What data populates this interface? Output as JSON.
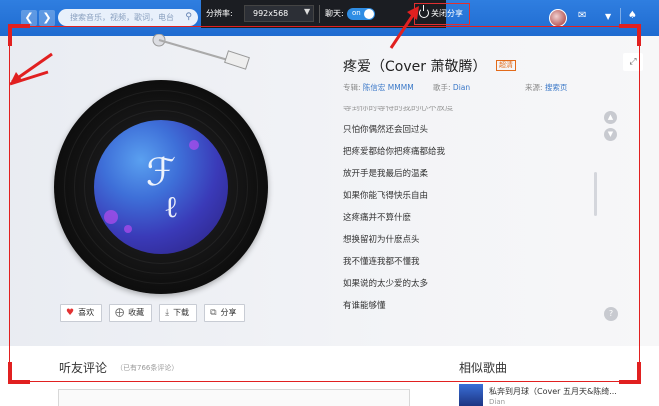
{
  "header": {
    "search_placeholder": "搜索音乐，视频，歌词，电台",
    "share_bar": {
      "resolution_label": "分辨率:",
      "resolution_value": "992x568",
      "chat_label": "聊天:",
      "chat_toggle": "on",
      "close_share_label": "关闭分享"
    }
  },
  "song": {
    "title": "疼爱（Cover 萧敬腾）",
    "badge": "超清",
    "album_label": "专辑:",
    "album_value": "陈信宏 MMMM",
    "artist_label": "歌手:",
    "artist_value": "Dian",
    "source_label": "来源:",
    "source_value": "搜索页"
  },
  "lyrics": [
    "等到你的等待的我的心不放度",
    "只怕你偶然还会回过头",
    "把疼爱都给你把疼痛都给我",
    "放开手是我最后的温柔",
    "如果你能飞得快乐自由",
    "这疼痛并不算什麽",
    "想换留初为什麽点头",
    "我不懂连我都不懂我",
    "如果说的太少爱的太多",
    "有谁能够懂"
  ],
  "actions": {
    "like": "喜欢",
    "collect": "收藏",
    "download": "下载",
    "share": "分享"
  },
  "comments": {
    "title": "听友评论",
    "count": "（已有766条评论）"
  },
  "similar": {
    "title": "相似歌曲",
    "song": "私奔到月球（Cover 五月天&陈绮...",
    "artist": "Dian"
  },
  "colors": {
    "topbar": "#2f7ee0",
    "accent_link": "#3a78c8",
    "annotation_red": "#e12020"
  }
}
